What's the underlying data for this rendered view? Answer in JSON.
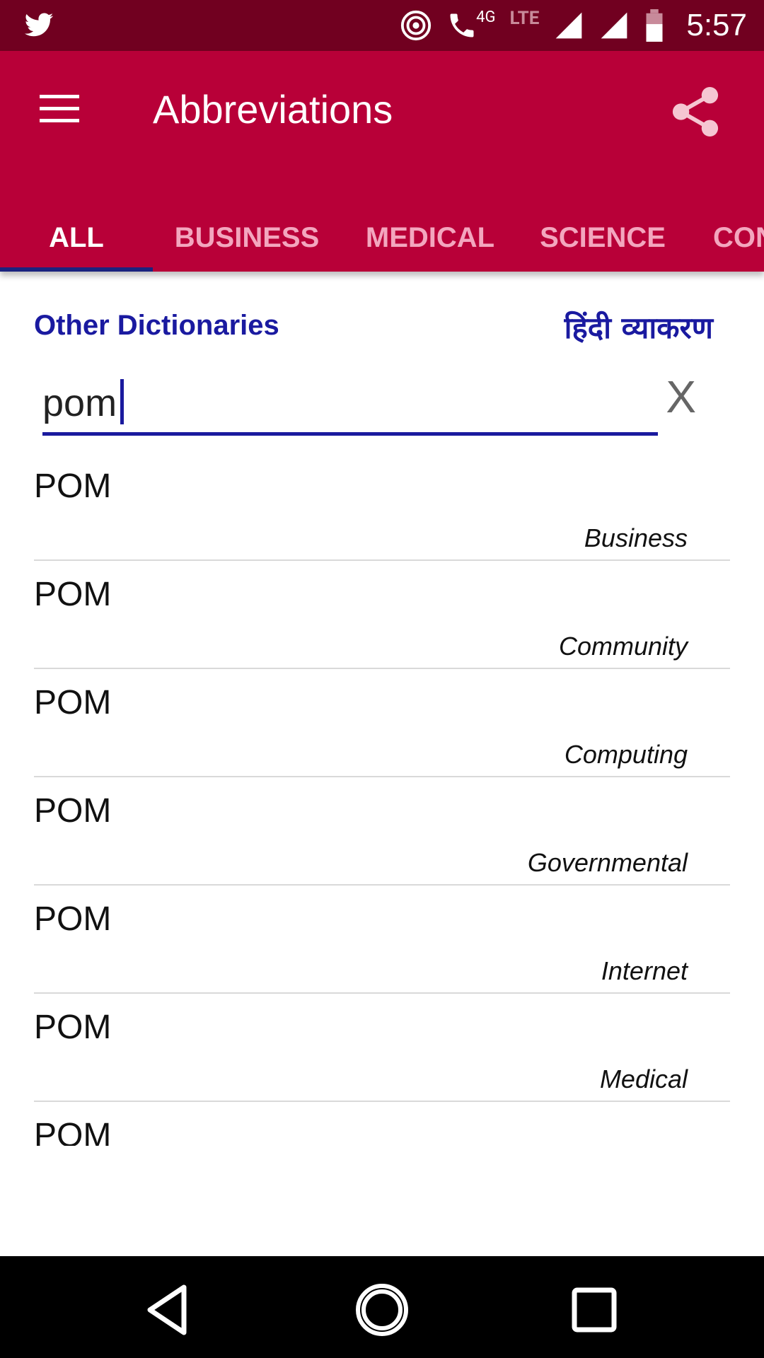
{
  "status_bar": {
    "time": "5:57",
    "network_label": "4G",
    "lte_label": "LTE",
    "icons": [
      "twitter-icon",
      "hotspot-icon",
      "wifi-call-icon",
      "signal-icon",
      "signal-icon",
      "battery-icon"
    ]
  },
  "app_bar": {
    "title": "Abbreviations",
    "menu_icon": "hamburger-icon",
    "share_icon": "share-icon",
    "background": "#b80038"
  },
  "tabs": [
    {
      "label": "ALL",
      "active": true
    },
    {
      "label": "BUSINESS",
      "active": false
    },
    {
      "label": "MEDICAL",
      "active": false
    },
    {
      "label": "SCIENCE",
      "active": false
    },
    {
      "label": "CON",
      "active": false
    }
  ],
  "links": {
    "other_dictionaries": "Other Dictionaries",
    "hindi_grammar": "हिंदी व्याकरण"
  },
  "search": {
    "value": "pom",
    "clear_label": "X"
  },
  "results": [
    {
      "abbr": "POM",
      "category": "Business"
    },
    {
      "abbr": "POM",
      "category": "Community"
    },
    {
      "abbr": "POM",
      "category": "Computing"
    },
    {
      "abbr": "POM",
      "category": "Governmental"
    },
    {
      "abbr": "POM",
      "category": "Internet"
    },
    {
      "abbr": "POM",
      "category": "Medical"
    },
    {
      "abbr": "POM",
      "category": ""
    }
  ],
  "nav_bar": {
    "buttons": [
      "back-icon",
      "home-icon",
      "recents-icon"
    ]
  }
}
